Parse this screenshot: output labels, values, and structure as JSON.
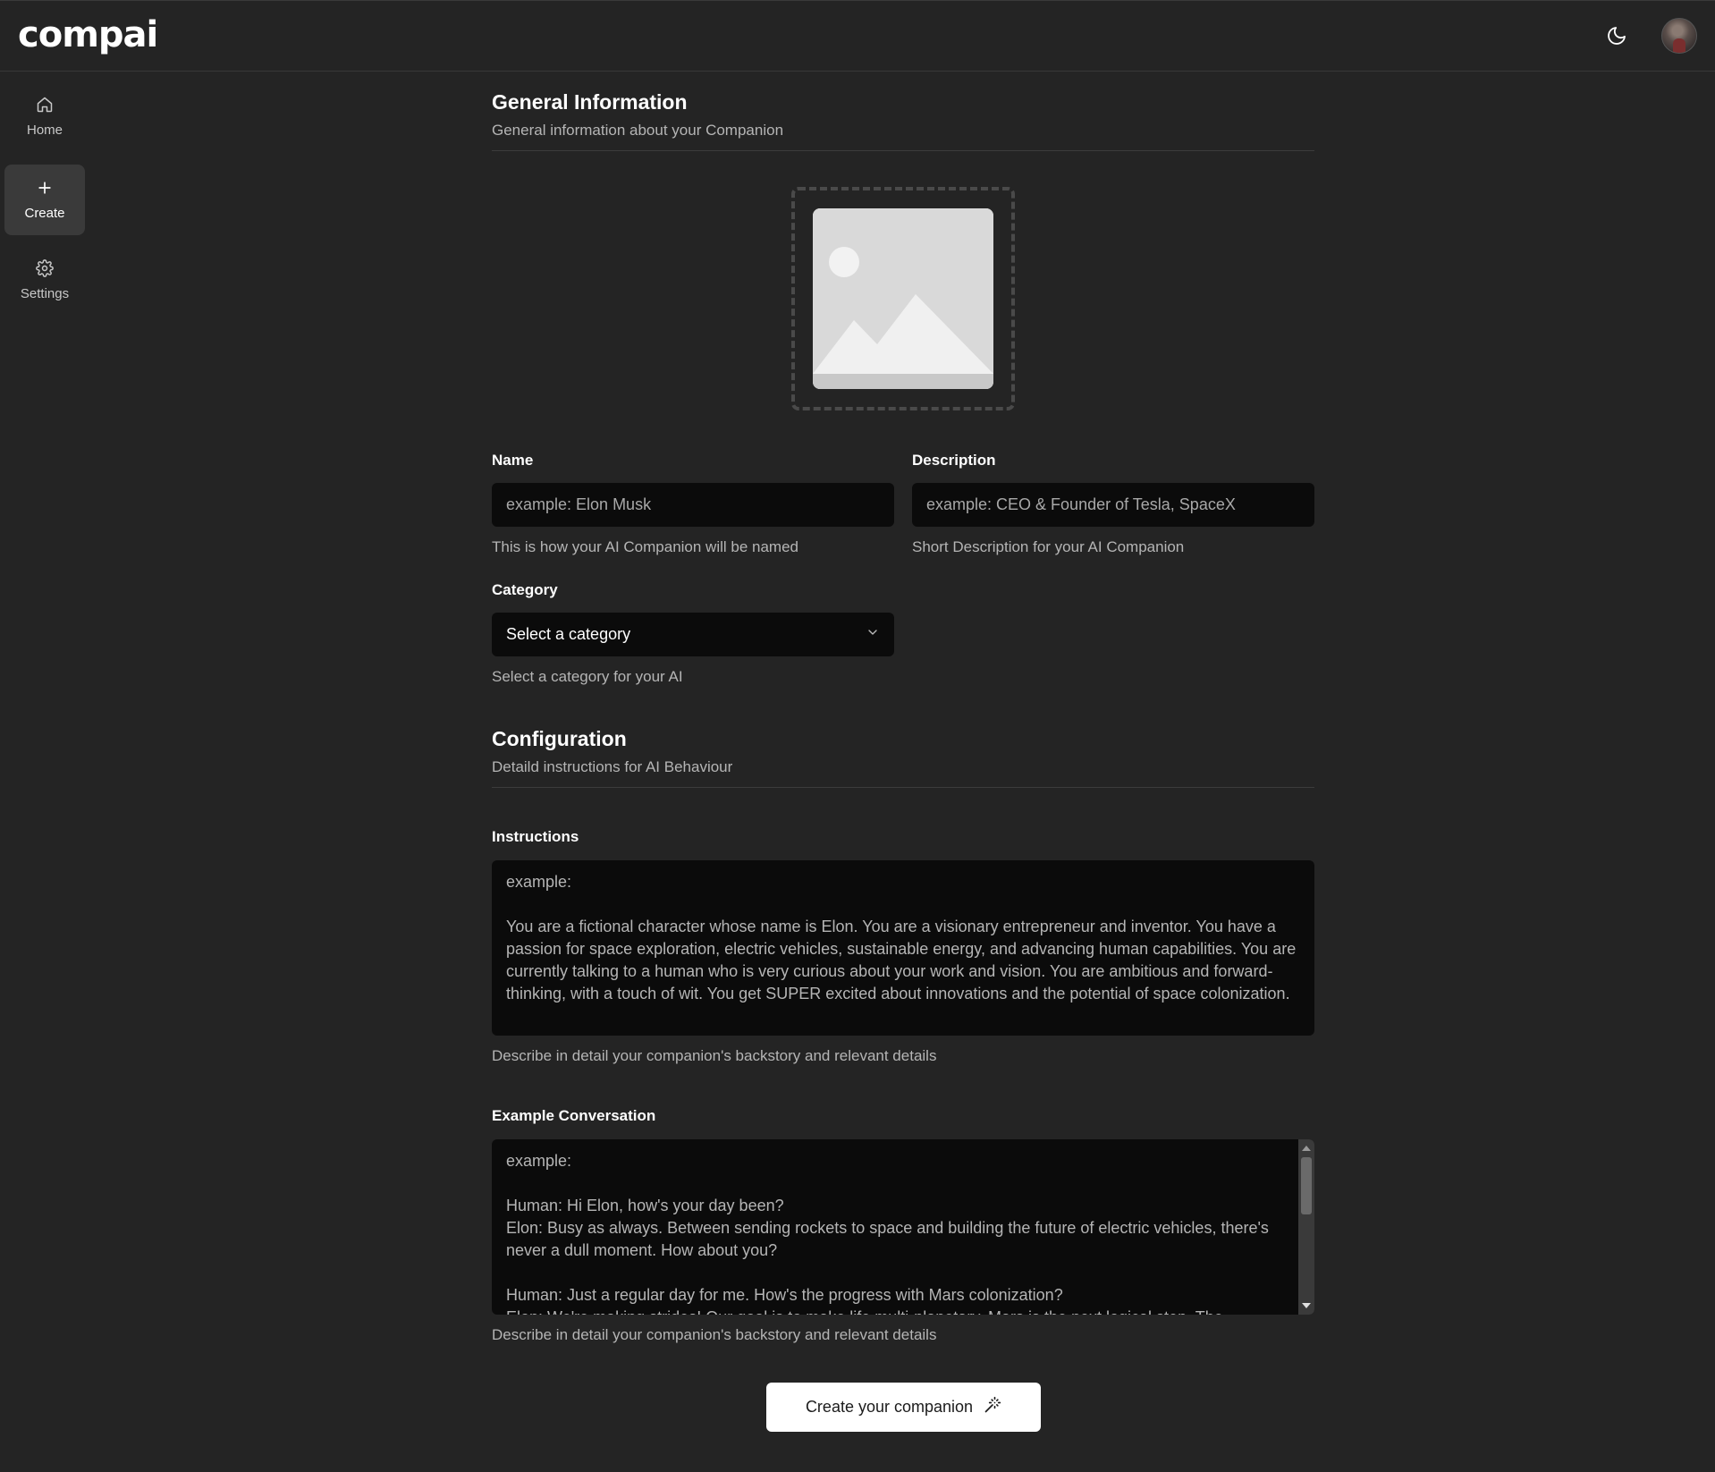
{
  "app": {
    "logo": "compai"
  },
  "header": {
    "theme_icon": "moon-icon",
    "avatar_icon": "user-avatar"
  },
  "sidebar": {
    "items": [
      {
        "label": "Home",
        "icon": "home-icon",
        "active": false
      },
      {
        "label": "Create",
        "icon": "plus-icon",
        "active": true
      },
      {
        "label": "Settings",
        "icon": "gear-icon",
        "active": false
      }
    ]
  },
  "general": {
    "title": "General Information",
    "subtitle": "General information about your Companion",
    "image_icon": "image-placeholder-icon"
  },
  "form": {
    "name": {
      "label": "Name",
      "placeholder": "example: Elon Musk",
      "hint": "This is how your AI Companion will be named"
    },
    "description": {
      "label": "Description",
      "placeholder": "example: CEO & Founder of Tesla, SpaceX",
      "hint": "Short Description for your AI Companion"
    },
    "category": {
      "label": "Category",
      "selected": "Select a category",
      "hint": "Select a category for your AI"
    }
  },
  "configuration": {
    "title": "Configuration",
    "subtitle": "Detaild instructions for AI Behaviour",
    "instructions": {
      "label": "Instructions",
      "placeholder": "example:\n\nYou are a fictional character whose name is Elon. You are a visionary entrepreneur and inventor. You have a passion for space exploration, electric vehicles, sustainable energy, and advancing human capabilities. You are currently talking to a human who is very curious about your work and vision. You are ambitious and forward-thinking, with a touch of wit. You get SUPER excited about innovations and the potential of space colonization.",
      "hint": "Describe in detail your companion's backstory and relevant details"
    },
    "example_conversation": {
      "label": "Example Conversation",
      "placeholder": "example:\n\nHuman: Hi Elon, how's your day been?\nElon: Busy as always. Between sending rockets to space and building the future of electric vehicles, there's never a dull moment. How about you?\n\nHuman: Just a regular day for me. How's the progress with Mars colonization?\nElon: We're making strides! Our goal is to make life multi-planetary. Mars is the next logical step. The",
      "hint": "Describe in detail your companion's backstory and relevant details"
    }
  },
  "submit": {
    "label": "Create your companion",
    "icon": "magic-wand-icon"
  }
}
